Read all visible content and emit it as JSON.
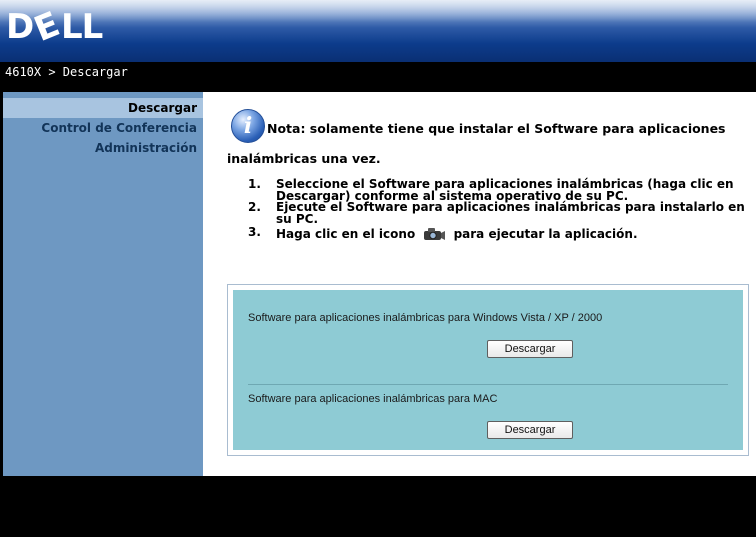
{
  "header": {
    "logo_text": "D⊘LL"
  },
  "breadcrumb": {
    "text": "4610X > Descargar"
  },
  "sidebar": {
    "items": [
      {
        "label": "Descargar",
        "active": true
      },
      {
        "label": "Control de Conferencia",
        "active": false
      },
      {
        "label": "Administración",
        "active": false
      }
    ]
  },
  "main": {
    "note_line1": "Nota: solamente tiene que instalar el Software para aplicaciones",
    "note_line2": "inalámbricas una vez.",
    "steps": [
      {
        "num": "1.",
        "text": "Seleccione el Software para aplicaciones inalámbricas (haga clic en Descargar) conforme al sistema operativo de su PC."
      },
      {
        "num": "2.",
        "text": "Ejecute el Software para aplicaciones inalámbricas para instalarlo en su PC."
      },
      {
        "num": "3.",
        "text_before": "Haga clic en el icono",
        "text_after": "para ejecutar la aplicación."
      }
    ],
    "downloads": [
      {
        "label": "Software para aplicaciones inalámbricas para Windows Vista / XP / 2000",
        "button": "Descargar"
      },
      {
        "label": "Software para aplicaciones inalámbricas para MAC",
        "button": "Descargar"
      }
    ]
  },
  "colors": {
    "sidebar": "#6e98c2",
    "sidebar_active": "#a8c4e0",
    "download_panel": "#8ecbd4",
    "header_blue": "#0d3c8c"
  },
  "icons": [
    "dell-logo",
    "info-icon",
    "projector-camera-icon"
  ]
}
